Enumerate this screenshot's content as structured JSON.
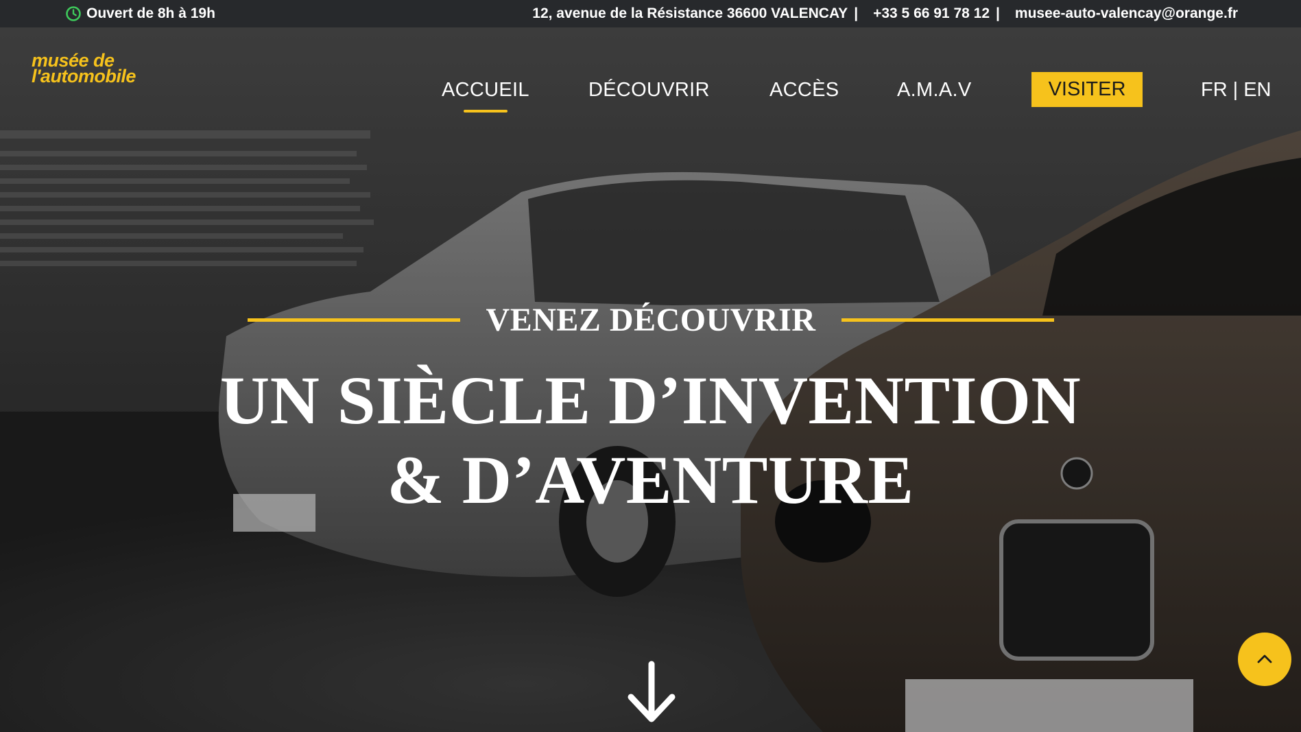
{
  "topbar": {
    "hours": "Ouvert de 8h à 19h",
    "address": "12, avenue de la Résistance 36600 VALENCAY",
    "phone": "+33 5 66 91 78 12",
    "email": "musee-auto-valencay@orange.fr",
    "separator": "|",
    "icon": "clock-icon",
    "icon_color": "#3ec95b"
  },
  "logo": {
    "line1": "musée de",
    "line2": "l'automobile",
    "color": "#f6c21c"
  },
  "nav": {
    "items": [
      {
        "label": "ACCUEIL",
        "active": true
      },
      {
        "label": "DÉCOUVRIR"
      },
      {
        "label": "ACCÈS"
      },
      {
        "label": "A.M.A.V"
      }
    ],
    "cta": "VISITER",
    "lang_fr": "FR",
    "lang_sep": "|",
    "lang_en": "EN"
  },
  "hero": {
    "kicker": "VENEZ DÉCOUVRIR",
    "title_line1": "UN SIÈCLE D’INVENTION",
    "title_line2": "& D’AVENTURE",
    "scroll_icon": "arrow-down-icon",
    "background": "museum-cars-photo"
  },
  "back_to_top": {
    "icon": "chevron-up-icon"
  },
  "colors": {
    "accent": "#f6c21c",
    "topbar_bg": "#27292c",
    "text": "#ffffff"
  }
}
